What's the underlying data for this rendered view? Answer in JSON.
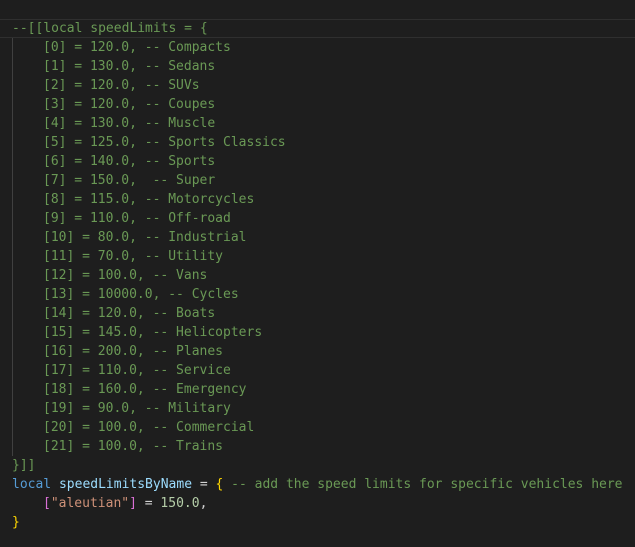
{
  "code": {
    "header": "--[[local speedLimits = {",
    "entries": [
      "[0] = 120.0, -- Compacts",
      "[1] = 130.0, -- Sedans",
      "[2] = 120.0, -- SUVs",
      "[3] = 120.0, -- Coupes",
      "[4] = 130.0, -- Muscle",
      "[5] = 125.0, -- Sports Classics",
      "[6] = 140.0, -- Sports",
      "[7] = 150.0,  -- Super",
      "[8] = 115.0, -- Motorcycles",
      "[9] = 110.0, -- Off-road",
      "[10] = 80.0, -- Industrial",
      "[11] = 70.0, -- Utility",
      "[12] = 100.0, -- Vans",
      "[13] = 10000.0, -- Cycles",
      "[14] = 120.0, -- Boats",
      "[15] = 145.0, -- Helicopters",
      "[16] = 200.0, -- Planes",
      "[17] = 110.0, -- Service",
      "[18] = 160.0, -- Emergency",
      "[19] = 90.0, -- Military",
      "[20] = 100.0, -- Commercial",
      "[21] = 100.0, -- Trains"
    ],
    "footer": "}]]",
    "decl": {
      "keyword": "local",
      "name": "speedLimitsByName",
      "assign": "=",
      "open_brace": "{",
      "comment": "-- add the speed limits for specific vehicles here"
    },
    "entry": {
      "open_bracket": "[",
      "key": "\"aleutian\"",
      "close_bracket": "]",
      "assign": "=",
      "value": "150.0",
      "comma": ","
    },
    "close_brace": "}"
  },
  "colors": {
    "background": "#1e1e1e",
    "comment": "#6a9955",
    "keyword": "#569cd6",
    "variable": "#9cdcfe",
    "operator": "#d4d4d4",
    "brace": "#ffd700",
    "bracket": "#da70d6",
    "string": "#ce9178",
    "number": "#b5cea8"
  }
}
